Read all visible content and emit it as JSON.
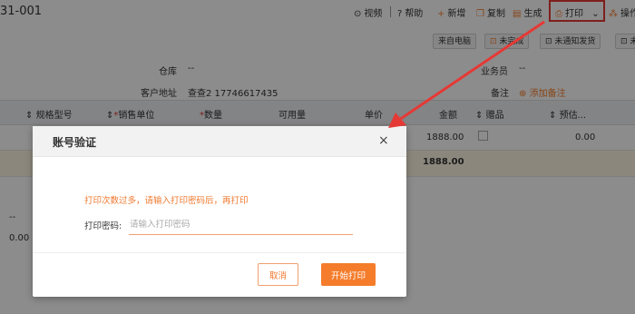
{
  "toolbar": {
    "doc_id": "31-001",
    "video": "视频",
    "help": "帮助",
    "new": "新增",
    "copy": "复制",
    "generate": "生成",
    "print": "打印",
    "operate": "操作",
    "icons": {
      "video": "video-icon",
      "help": "help-icon",
      "new": "plus-icon",
      "copy": "copy-icon",
      "generate": "generate-icon",
      "print": "printer-icon",
      "dropdown": "chevron-down-icon",
      "operate": "operate-icon"
    }
  },
  "tags": {
    "from_pc": "来自电脑",
    "incomplete": "未完成",
    "not_notified": "未通知发货",
    "more": "未"
  },
  "fields": {
    "warehouse_label": "仓库",
    "warehouse_value": "--",
    "address_label": "客户地址",
    "address_value": "查查2 17746617435",
    "salesperson_label": "业务员",
    "salesperson_value": "--",
    "remark_label": "备注",
    "add_remark": "添加备注"
  },
  "table": {
    "headers": {
      "spec": "规格型号",
      "sale_unit": "销售单位",
      "quantity": "数量",
      "available": "可用量",
      "unit_price": "单价",
      "amount": "金额",
      "gift": "赠品",
      "estimated": "预估..."
    },
    "row1": {
      "amount": "1888.00",
      "estimated": "0.00"
    },
    "total": {
      "amount": "1888.00"
    },
    "side_values": {
      "dash": "--",
      "zero": "0.00"
    }
  },
  "modal": {
    "title": "账号验证",
    "close": "×",
    "warning": "打印次数过多，请输入打印密码后，再打印",
    "password_label": "打印密码:",
    "password_placeholder": "请输入打印密码",
    "cancel": "取消",
    "start_print": "开始打印"
  },
  "colors": {
    "accent": "#f57c2b",
    "highlight_box": "#e53935",
    "arrow": "#e53935"
  }
}
